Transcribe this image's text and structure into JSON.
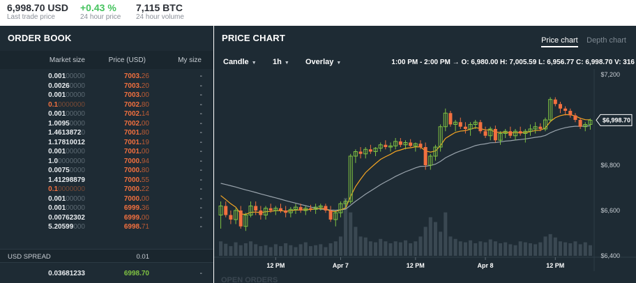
{
  "topbar": {
    "last_trade_value": "6,998.70 USD",
    "last_trade_label": "Last trade price",
    "change_value": "+0.43 %",
    "change_label": "24 hour price",
    "volume_value": "7,115 BTC",
    "volume_label": "24 hour volume"
  },
  "orderbook": {
    "title": "ORDER BOOK",
    "col_market_size": "Market size",
    "col_price": "Price (USD)",
    "col_my_size": "My size",
    "asks": [
      {
        "size_main": "0.001",
        "size_dim": "00000",
        "price_main": "7003.",
        "price_dim": "26",
        "mine": "-",
        "highlight": false
      },
      {
        "size_main": "0.0026",
        "size_dim": "0000",
        "price_main": "7003.",
        "price_dim": "20",
        "mine": "-",
        "highlight": false
      },
      {
        "size_main": "0.001",
        "size_dim": "00000",
        "price_main": "7003.",
        "price_dim": "00",
        "mine": "-",
        "highlight": false
      },
      {
        "size_main": "0.1",
        "size_dim": "0000000",
        "price_main": "7002.",
        "price_dim": "80",
        "mine": "-",
        "highlight": true
      },
      {
        "size_main": "0.001",
        "size_dim": "00000",
        "price_main": "7002.",
        "price_dim": "14",
        "mine": "-",
        "highlight": false
      },
      {
        "size_main": "1.0095",
        "size_dim": "0000",
        "price_main": "7002.",
        "price_dim": "00",
        "mine": "-",
        "highlight": false
      },
      {
        "size_main": "1.4613872",
        "size_dim": "0",
        "price_main": "7001.",
        "price_dim": "80",
        "mine": "-",
        "highlight": false
      },
      {
        "size_main": "1.17810012",
        "size_dim": "",
        "price_main": "7001.",
        "price_dim": "19",
        "mine": "-",
        "highlight": false
      },
      {
        "size_main": "0.001",
        "size_dim": "00000",
        "price_main": "7001.",
        "price_dim": "00",
        "mine": "-",
        "highlight": false
      },
      {
        "size_main": "1.0",
        "size_dim": "0000000",
        "price_main": "7000.",
        "price_dim": "94",
        "mine": "-",
        "highlight": false
      },
      {
        "size_main": "0.0075",
        "size_dim": "0000",
        "price_main": "7000.",
        "price_dim": "80",
        "mine": "-",
        "highlight": false
      },
      {
        "size_main": "1.41298879",
        "size_dim": "",
        "price_main": "7000.",
        "price_dim": "55",
        "mine": "-",
        "highlight": false
      },
      {
        "size_main": "0.1",
        "size_dim": "0000000",
        "price_main": "7000.",
        "price_dim": "22",
        "mine": "-",
        "highlight": true
      },
      {
        "size_main": "0.001",
        "size_dim": "00000",
        "price_main": "7000.",
        "price_dim": "00",
        "mine": "-",
        "highlight": false
      },
      {
        "size_main": "0.001",
        "size_dim": "00000",
        "price_main": "6999.",
        "price_dim": "36",
        "mine": "-",
        "highlight": false
      },
      {
        "size_main": "0.00762302",
        "size_dim": "",
        "price_main": "6999.",
        "price_dim": "00",
        "mine": "-",
        "highlight": false
      },
      {
        "size_main": "5.20599",
        "size_dim": "000",
        "price_main": "6998.",
        "price_dim": "71",
        "mine": "-",
        "highlight": false
      }
    ],
    "spread_label": "USD SPREAD",
    "spread_value": "0.01",
    "bid": {
      "size_main": "0.03681233",
      "size_dim": "",
      "price_main": "6998.",
      "price_dim": "70",
      "mine": "-"
    }
  },
  "pricechart": {
    "title": "PRICE CHART",
    "tab_price": "Price chart",
    "tab_depth": "Depth chart",
    "tool_candle": "Candle",
    "tool_interval": "1h",
    "tool_overlay": "Overlay",
    "ohlc_range": "1:00 PM - 2:00 PM →",
    "ohlc_open": "O: 6,980.00",
    "ohlc_high": "H: 7,005.59",
    "ohlc_low": "L: 6,956.77",
    "ohlc_close": "C: 6,998.70",
    "ohlc_volume": "V: 316",
    "current_price_label": "$6,998.70",
    "y_ticks": [
      "$7,200",
      "$7,000",
      "$6,800",
      "$6,600",
      "$6,400"
    ],
    "x_ticks": [
      "12 PM",
      "Apr 7",
      "12 PM",
      "Apr 8",
      "12 PM"
    ],
    "open_orders_peek": "OPEN ORDERS"
  },
  "colors": {
    "bg": "#1e2b34",
    "ask": "#f2703f",
    "bid": "#7fc242",
    "candle_up": "#7fc242",
    "candle_down": "#f2703f",
    "ema_fast": "#f5a623",
    "ema_slow": "#9aa4ad"
  },
  "chart_data": {
    "type": "candlestick",
    "ylim": [
      6400,
      7200
    ],
    "candles": [
      [
        6580,
        6640,
        6520,
        6620
      ],
      [
        6620,
        6640,
        6570,
        6580
      ],
      [
        6580,
        6600,
        6540,
        6560
      ],
      [
        6560,
        6610,
        6540,
        6600
      ],
      [
        6600,
        6620,
        6520,
        6530
      ],
      [
        6530,
        6590,
        6510,
        6580
      ],
      [
        6580,
        6640,
        6570,
        6620
      ],
      [
        6620,
        6640,
        6580,
        6600
      ],
      [
        6600,
        6620,
        6560,
        6580
      ],
      [
        6580,
        6620,
        6560,
        6610
      ],
      [
        6610,
        6630,
        6590,
        6600
      ],
      [
        6600,
        6620,
        6580,
        6610
      ],
      [
        6610,
        6630,
        6590,
        6600
      ],
      [
        6600,
        6620,
        6570,
        6590
      ],
      [
        6590,
        6615,
        6570,
        6605
      ],
      [
        6605,
        6630,
        6585,
        6615
      ],
      [
        6615,
        6630,
        6590,
        6600
      ],
      [
        6600,
        6620,
        6580,
        6610
      ],
      [
        6610,
        6625,
        6595,
        6605
      ],
      [
        6605,
        6630,
        6585,
        6615
      ],
      [
        6615,
        6630,
        6600,
        6620
      ],
      [
        6620,
        6630,
        6590,
        6600
      ],
      [
        6600,
        6620,
        6550,
        6560
      ],
      [
        6560,
        6600,
        6530,
        6590
      ],
      [
        6590,
        6640,
        6570,
        6630
      ],
      [
        6630,
        6650,
        6610,
        6640
      ],
      [
        6640,
        6850,
        6630,
        6840
      ],
      [
        6840,
        6870,
        6810,
        6860
      ],
      [
        6860,
        6880,
        6830,
        6850
      ],
      [
        6850,
        6880,
        6830,
        6870
      ],
      [
        6870,
        6890,
        6850,
        6860
      ],
      [
        6860,
        6880,
        6840,
        6875
      ],
      [
        6875,
        6900,
        6860,
        6890
      ],
      [
        6890,
        6910,
        6870,
        6880
      ],
      [
        6880,
        6900,
        6860,
        6885
      ],
      [
        6885,
        6920,
        6870,
        6905
      ],
      [
        6905,
        6920,
        6880,
        6890
      ],
      [
        6890,
        6910,
        6870,
        6900
      ],
      [
        6900,
        6915,
        6880,
        6885
      ],
      [
        6885,
        6900,
        6860,
        6895
      ],
      [
        6895,
        6910,
        6870,
        6880
      ],
      [
        6880,
        6900,
        6780,
        6800
      ],
      [
        6800,
        6850,
        6780,
        6840
      ],
      [
        6840,
        6890,
        6820,
        6880
      ],
      [
        6880,
        6980,
        6860,
        6970
      ],
      [
        6970,
        7050,
        6950,
        7030
      ],
      [
        7030,
        7040,
        6970,
        6980
      ],
      [
        6980,
        7000,
        6950,
        6990
      ],
      [
        6990,
        7010,
        6960,
        6970
      ],
      [
        6970,
        6990,
        6940,
        6960
      ],
      [
        6960,
        6990,
        6930,
        6980
      ],
      [
        6980,
        7000,
        6960,
        6990
      ],
      [
        6990,
        7000,
        6940,
        6950
      ],
      [
        6950,
        6970,
        6920,
        6930
      ],
      [
        6930,
        6970,
        6910,
        6960
      ],
      [
        6960,
        6975,
        6900,
        6910
      ],
      [
        6910,
        6950,
        6890,
        6940
      ],
      [
        6940,
        6960,
        6920,
        6950
      ],
      [
        6950,
        6970,
        6920,
        6930
      ],
      [
        6930,
        6960,
        6910,
        6950
      ],
      [
        6950,
        6970,
        6930,
        6940
      ],
      [
        6940,
        6960,
        6900,
        6950
      ],
      [
        6950,
        6980,
        6930,
        6960
      ],
      [
        6960,
        6990,
        6940,
        6970
      ],
      [
        6970,
        6985,
        6950,
        6960
      ],
      [
        6960,
        7010,
        6950,
        7000
      ],
      [
        7000,
        7100,
        6990,
        7090
      ],
      [
        7090,
        7100,
        7060,
        7070
      ],
      [
        7070,
        7080,
        7030,
        7050
      ],
      [
        7050,
        7060,
        7020,
        7040
      ],
      [
        7040,
        7050,
        7010,
        7020
      ],
      [
        7020,
        7030,
        6990,
        7000
      ],
      [
        7000,
        7010,
        6960,
        6970
      ],
      [
        6970,
        6990,
        6950,
        6980
      ],
      [
        6980,
        7005.59,
        6956.77,
        6998.7
      ]
    ],
    "volumes": [
      30,
      25,
      20,
      28,
      22,
      26,
      30,
      24,
      20,
      22,
      18,
      24,
      20,
      26,
      22,
      18,
      24,
      28,
      20,
      22,
      24,
      18,
      26,
      30,
      40,
      120,
      90,
      60,
      40,
      38,
      30,
      28,
      35,
      30,
      26,
      30,
      28,
      32,
      26,
      30,
      40,
      60,
      80,
      70,
      50,
      90,
      40,
      35,
      30,
      28,
      32,
      26,
      30,
      28,
      34,
      30,
      26,
      28,
      24,
      22,
      30,
      28,
      26,
      24,
      28,
      40,
      45,
      38,
      30,
      28,
      26,
      30,
      24,
      28,
      22
    ]
  }
}
